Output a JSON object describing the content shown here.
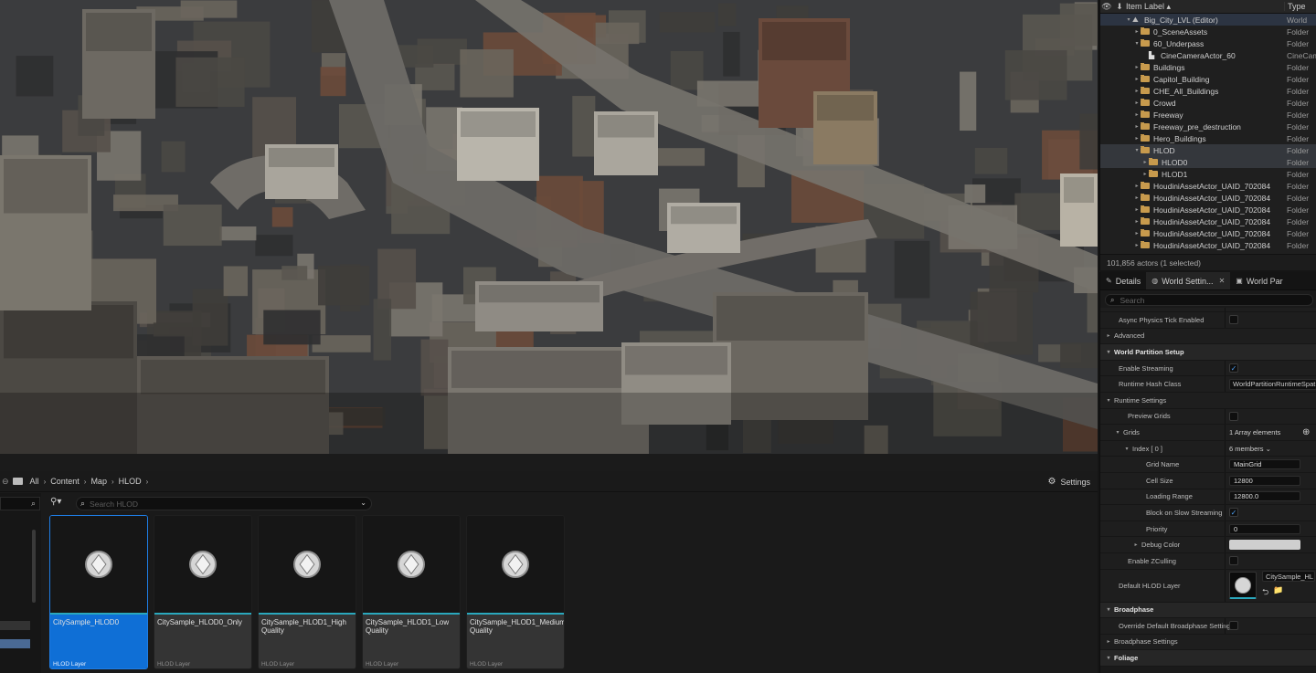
{
  "outliner": {
    "header_label": "Item Label ▴",
    "header_type": "Type",
    "rows": [
      {
        "indent": 3,
        "arrow": "▾",
        "icon": "world",
        "label": "Big_City_LVL (Editor)",
        "type": "World",
        "hl": "hl"
      },
      {
        "indent": 4,
        "arrow": "▸",
        "icon": "folder",
        "label": "0_SceneAssets",
        "type": "Folder",
        "hl": ""
      },
      {
        "indent": 4,
        "arrow": "▾",
        "icon": "folder",
        "label": "60_Underpass",
        "type": "Folder",
        "hl": ""
      },
      {
        "indent": 5,
        "arrow": "",
        "icon": "camera",
        "label": "CineCameraActor_60",
        "type": "CineCam",
        "hl": ""
      },
      {
        "indent": 4,
        "arrow": "▸",
        "icon": "folder",
        "label": "Buildings",
        "type": "Folder",
        "hl": ""
      },
      {
        "indent": 4,
        "arrow": "▸",
        "icon": "folder",
        "label": "Capitol_Building",
        "type": "Folder",
        "hl": ""
      },
      {
        "indent": 4,
        "arrow": "▸",
        "icon": "folder",
        "label": "CHE_All_Buildings",
        "type": "Folder",
        "hl": ""
      },
      {
        "indent": 4,
        "arrow": "▸",
        "icon": "folder",
        "label": "Crowd",
        "type": "Folder",
        "hl": ""
      },
      {
        "indent": 4,
        "arrow": "▸",
        "icon": "folder",
        "label": "Freeway",
        "type": "Folder",
        "hl": ""
      },
      {
        "indent": 4,
        "arrow": "▸",
        "icon": "folder",
        "label": "Freeway_pre_destruction",
        "type": "Folder",
        "hl": ""
      },
      {
        "indent": 4,
        "arrow": "▸",
        "icon": "folder",
        "label": "Hero_Buildings",
        "type": "Folder",
        "hl": ""
      },
      {
        "indent": 4,
        "arrow": "▾",
        "icon": "folder",
        "label": "HLOD",
        "type": "Folder",
        "hl": "hl2"
      },
      {
        "indent": 5,
        "arrow": "▸",
        "icon": "folder",
        "label": "HLOD0",
        "type": "Folder",
        "hl": "hl2"
      },
      {
        "indent": 5,
        "arrow": "▸",
        "icon": "folder",
        "label": "HLOD1",
        "type": "Folder",
        "hl": ""
      },
      {
        "indent": 4,
        "arrow": "▸",
        "icon": "folder",
        "label": "HoudiniAssetActor_UAID_702084",
        "type": "Folder",
        "hl": ""
      },
      {
        "indent": 4,
        "arrow": "▸",
        "icon": "folder",
        "label": "HoudiniAssetActor_UAID_702084",
        "type": "Folder",
        "hl": ""
      },
      {
        "indent": 4,
        "arrow": "▸",
        "icon": "folder",
        "label": "HoudiniAssetActor_UAID_702084",
        "type": "Folder",
        "hl": ""
      },
      {
        "indent": 4,
        "arrow": "▸",
        "icon": "folder",
        "label": "HoudiniAssetActor_UAID_702084",
        "type": "Folder",
        "hl": ""
      },
      {
        "indent": 4,
        "arrow": "▸",
        "icon": "folder",
        "label": "HoudiniAssetActor_UAID_702084",
        "type": "Folder",
        "hl": ""
      },
      {
        "indent": 4,
        "arrow": "▸",
        "icon": "folder",
        "label": "HoudiniAssetActor_UAID_702084",
        "type": "Folder",
        "hl": ""
      }
    ],
    "footer": "101,856 actors (1 selected)"
  },
  "details": {
    "tab_details": "Details",
    "tab_world_settings": "World Settin...",
    "tab_world_partition": "World Par",
    "search_placeholder": "Search",
    "rows": [
      {
        "indent": 1,
        "kind": "prop",
        "label": "Async Physics Tick Enabled",
        "value": "",
        "control": "checkbox",
        "checked": false
      },
      {
        "indent": 0,
        "kind": "sub",
        "arrow": "▸",
        "label": "Advanced"
      },
      {
        "indent": 0,
        "kind": "cat",
        "arrow": "▾",
        "label": "World Partition Setup"
      },
      {
        "indent": 1,
        "kind": "prop",
        "label": "Enable Streaming",
        "control": "checkbox",
        "checked": true
      },
      {
        "indent": 1,
        "kind": "prop",
        "label": "Runtime Hash Class",
        "control": "combo",
        "value": "WorldPartitionRuntimeSpat ▾"
      },
      {
        "indent": 0,
        "kind": "sub",
        "arrow": "▾",
        "label": "Runtime Settings"
      },
      {
        "indent": 2,
        "kind": "prop",
        "label": "Preview Grids",
        "control": "checkbox",
        "checked": false
      },
      {
        "indent": 1,
        "kind": "sub",
        "arrow": "▾",
        "label": "Grids",
        "control": "text",
        "value": "1 Array elements",
        "add": true
      },
      {
        "indent": 2,
        "kind": "sub",
        "arrow": "▾",
        "label": "Index [ 0 ]",
        "control": "text",
        "value": "6 members ⌄"
      },
      {
        "indent": 4,
        "kind": "prop",
        "label": "Grid Name",
        "control": "textbox",
        "value": "MainGrid"
      },
      {
        "indent": 4,
        "kind": "prop",
        "label": "Cell Size",
        "control": "textbox",
        "value": "12800"
      },
      {
        "indent": 4,
        "kind": "prop",
        "label": "Loading Range",
        "control": "textbox",
        "value": "12800.0"
      },
      {
        "indent": 4,
        "kind": "prop",
        "label": "Block on Slow Streaming",
        "control": "checkbox",
        "checked": true
      },
      {
        "indent": 4,
        "kind": "prop",
        "label": "Priority",
        "control": "textbox",
        "value": "0"
      },
      {
        "indent": 3,
        "kind": "sub",
        "arrow": "▸",
        "label": "Debug Color",
        "control": "color"
      },
      {
        "indent": 2,
        "kind": "prop",
        "label": "Enable ZCulling",
        "control": "checkbox",
        "checked": false
      },
      {
        "indent": 1,
        "kind": "tall",
        "label": "Default HLOD Layer",
        "control": "asset",
        "value": "CitySample_HL"
      },
      {
        "indent": 0,
        "kind": "cat",
        "arrow": "▾",
        "label": "Broadphase"
      },
      {
        "indent": 1,
        "kind": "prop",
        "label": "Override Default Broadphase Settings",
        "control": "checkbox",
        "checked": false
      },
      {
        "indent": 0,
        "kind": "sub",
        "arrow": "▸",
        "label": "Broadphase Settings"
      },
      {
        "indent": 0,
        "kind": "cat",
        "arrow": "▾",
        "label": "Foliage"
      }
    ]
  },
  "content_browser": {
    "breadcrumb": [
      "All",
      "Content",
      "Map",
      "HLOD"
    ],
    "settings_label": "Settings",
    "search_placeholder": "Search HLOD",
    "assets": [
      {
        "name": "CitySample_HLOD0",
        "type": "HLOD Layer",
        "selected": true
      },
      {
        "name": "CitySample_HLOD0_Only",
        "type": "HLOD Layer",
        "selected": false
      },
      {
        "name": "CitySample_HLOD1_High Quality",
        "type": "HLOD Layer",
        "selected": false
      },
      {
        "name": "CitySample_HLOD1_Low Quality",
        "type": "HLOD Layer",
        "selected": false
      },
      {
        "name": "CitySample_HLOD1_Medium Quality",
        "type": "HLOD Layer",
        "selected": false
      }
    ]
  },
  "colors": {
    "accent": "#0f6fd6",
    "folder": "#c79a4d",
    "checkmark": "#4d9df0",
    "asset_bar": "#2aa8bd"
  }
}
